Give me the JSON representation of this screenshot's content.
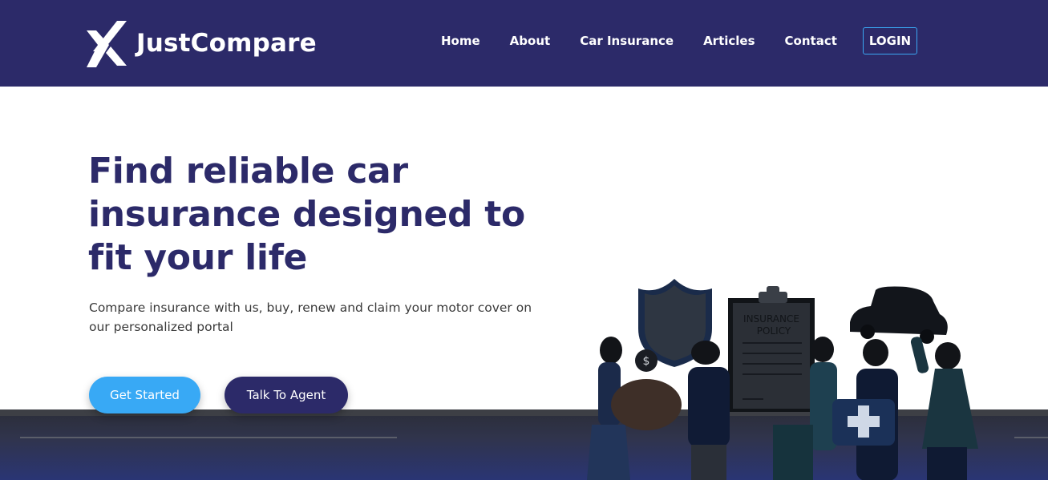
{
  "brand": {
    "name": "JustCompare",
    "logo_icon": "double-chevron-logo-icon"
  },
  "nav": {
    "items": [
      {
        "label": "Home"
      },
      {
        "label": "About"
      },
      {
        "label": "Car Insurance"
      },
      {
        "label": "Articles"
      },
      {
        "label": "Contact"
      }
    ],
    "login_label": "LOGIN"
  },
  "hero": {
    "title": "Find reliable car insurance designed to fit your life",
    "subtitle": "Compare insurance with us, buy, renew and claim your motor cover on our personalized portal",
    "primary_button": "Get Started",
    "secondary_button": "Talk To Agent"
  },
  "illustration": {
    "clipboard_line1": "INSURANCE",
    "clipboard_line2": "POLICY",
    "coin_symbol": "$"
  },
  "colors": {
    "navbar_bg": "#2c2a69",
    "title_color": "#2c2a69",
    "primary_button": "#38a9f5",
    "secondary_button": "#2c2a69",
    "login_border": "#3aa7f2"
  }
}
